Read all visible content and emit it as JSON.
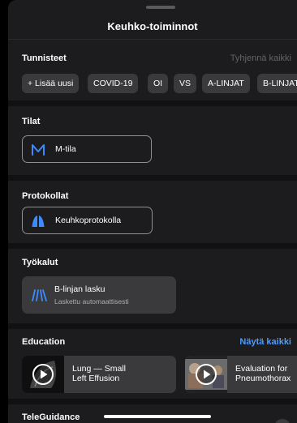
{
  "header": {
    "title": "Keuhko-toiminnot"
  },
  "tags": {
    "title": "Tunnisteet",
    "clear_label": "Tyhjennä kaikki",
    "chips": [
      "+ Lisää uusi",
      "COVID-19",
      "OI",
      "VS",
      "A-LINJAT",
      "B-LINJAT"
    ]
  },
  "modes": {
    "title": "Tilat",
    "button_label": "M-tila",
    "icon": "m-mode-icon"
  },
  "protocols": {
    "title": "Protokollat",
    "button_label": "Keuhkoprotokolla",
    "icon": "lungs-icon"
  },
  "tools": {
    "title": "Työkalut",
    "card_title": "B-linjan lasku",
    "card_subtitle": "Laskettu automaattisesti",
    "icon": "b-lines-icon"
  },
  "education": {
    "title": "Education",
    "see_all_label": "Näytä kaikki",
    "cards": [
      {
        "line1": "Lung — Small",
        "line2": "Left Effusion"
      },
      {
        "line1": "Evaluation for",
        "line2": "Pneumothorax"
      }
    ]
  },
  "teleguidance": {
    "title": "TeleGuidance"
  },
  "colors": {
    "accent": "#3d8bfd",
    "link": "#4a9cff",
    "disabled": "#636366",
    "sheet_bg": "#1c1c1e",
    "chip_bg": "#3a3a3c"
  }
}
